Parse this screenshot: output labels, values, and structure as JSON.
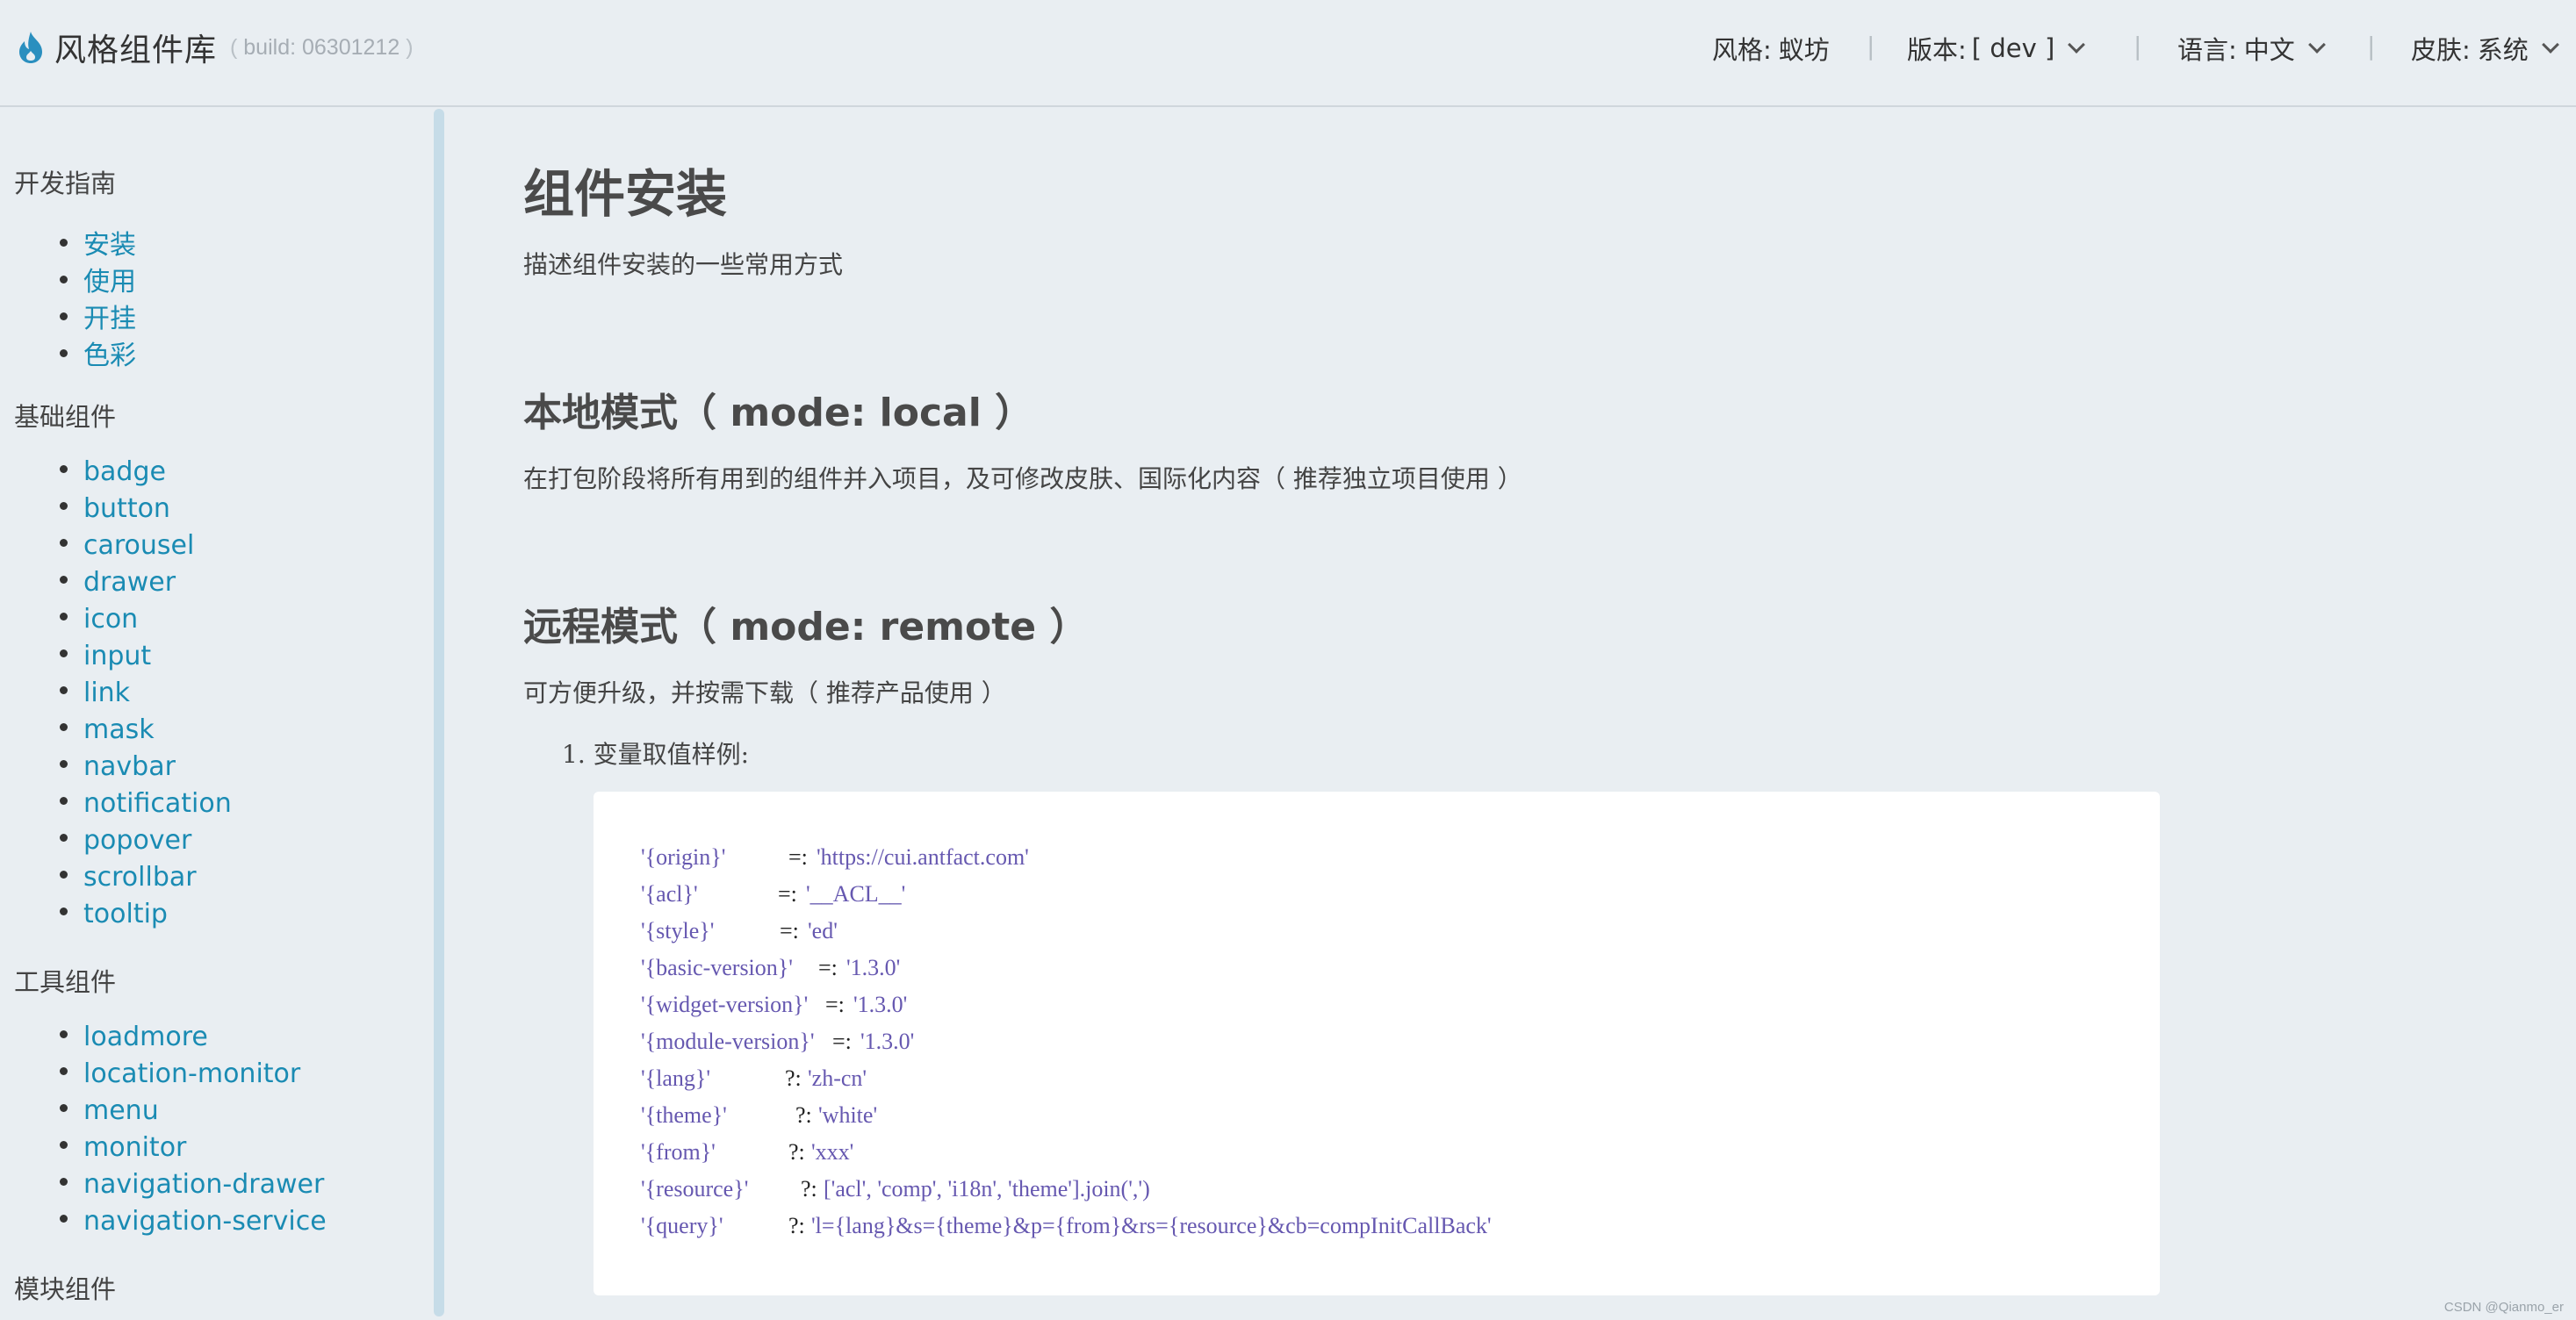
{
  "header": {
    "title": "风格组件库",
    "build_label": "build: 06301212",
    "build_open": "(",
    "build_close": ")",
    "style_label": "风格:",
    "style_value": "蚁坊",
    "version_label": "版本:",
    "version_value": "[ dev ]",
    "lang_label": "语言:",
    "lang_value": "中文",
    "skin_label": "皮肤:",
    "skin_value": "系统",
    "separator": "|"
  },
  "sidebar": {
    "sections": [
      {
        "title": "开发指南",
        "items": [
          "安装",
          "使用",
          "开挂",
          "色彩"
        ]
      },
      {
        "title": "基础组件",
        "items": [
          "badge",
          "button",
          "carousel",
          "drawer",
          "icon",
          "input",
          "link",
          "mask",
          "navbar",
          "notification",
          "popover",
          "scrollbar",
          "tooltip"
        ]
      },
      {
        "title": "工具组件",
        "items": [
          "loadmore",
          "location-monitor",
          "menu",
          "monitor",
          "navigation-drawer",
          "navigation-service"
        ]
      },
      {
        "title": "模块组件",
        "items": []
      }
    ]
  },
  "main": {
    "title": "组件安装",
    "subtitle": "描述组件安装的一些常用方式",
    "local_heading": "本地模式（ mode: local ）",
    "local_desc": "在打包阶段将所有用到的组件并入项目，及可修改皮肤、国际化内容（ 推荐独立项目使用 ）",
    "remote_heading": "远程模式（ mode: remote ）",
    "remote_desc": "可方便升级，并按需下载（ 推荐产品使用 ）",
    "list_item_1": "1. 变量取值样例:",
    "code": [
      {
        "key": "'{origin}'",
        "op": "=:",
        "value": "'https://cui.antfact.com'"
      },
      {
        "key": "'{acl}'",
        "op": "=:",
        "value": "'__ACL__'"
      },
      {
        "key": "'{style}'",
        "op": "=:",
        "value": "'ed'"
      },
      {
        "key": "'{basic-version}'",
        "op": "=:",
        "value": "'1.3.0'"
      },
      {
        "key": "'{widget-version}'",
        "op": "=:",
        "value": "'1.3.0'"
      },
      {
        "key": "'{module-version}'",
        "op": "=:",
        "value": "'1.3.0'"
      },
      {
        "key": "'{lang}'",
        "op": "?:",
        "value": "'zh-cn'"
      },
      {
        "key": "'{theme}'",
        "op": "?:",
        "value": "'white'"
      },
      {
        "key": "'{from}'",
        "op": "?:",
        "value": "'xxx'"
      },
      {
        "key": "'{resource}'",
        "op": "?:",
        "value": "['acl', 'comp', 'i18n', 'theme'].join(',')"
      },
      {
        "key": "'{query}'",
        "op": "?:",
        "value": "'l={lang}&s={theme}&p={from}&rs={resource}&cb=compInitCallBack'"
      }
    ]
  },
  "watermark": "CSDN @Qianmo_er",
  "colors": {
    "link": "#1a8bb3",
    "code_keyword": "#6658b0",
    "background": "#e9eef2",
    "logo": "#2a8fbf"
  },
  "icons": {
    "logo": "flame-icon"
  }
}
